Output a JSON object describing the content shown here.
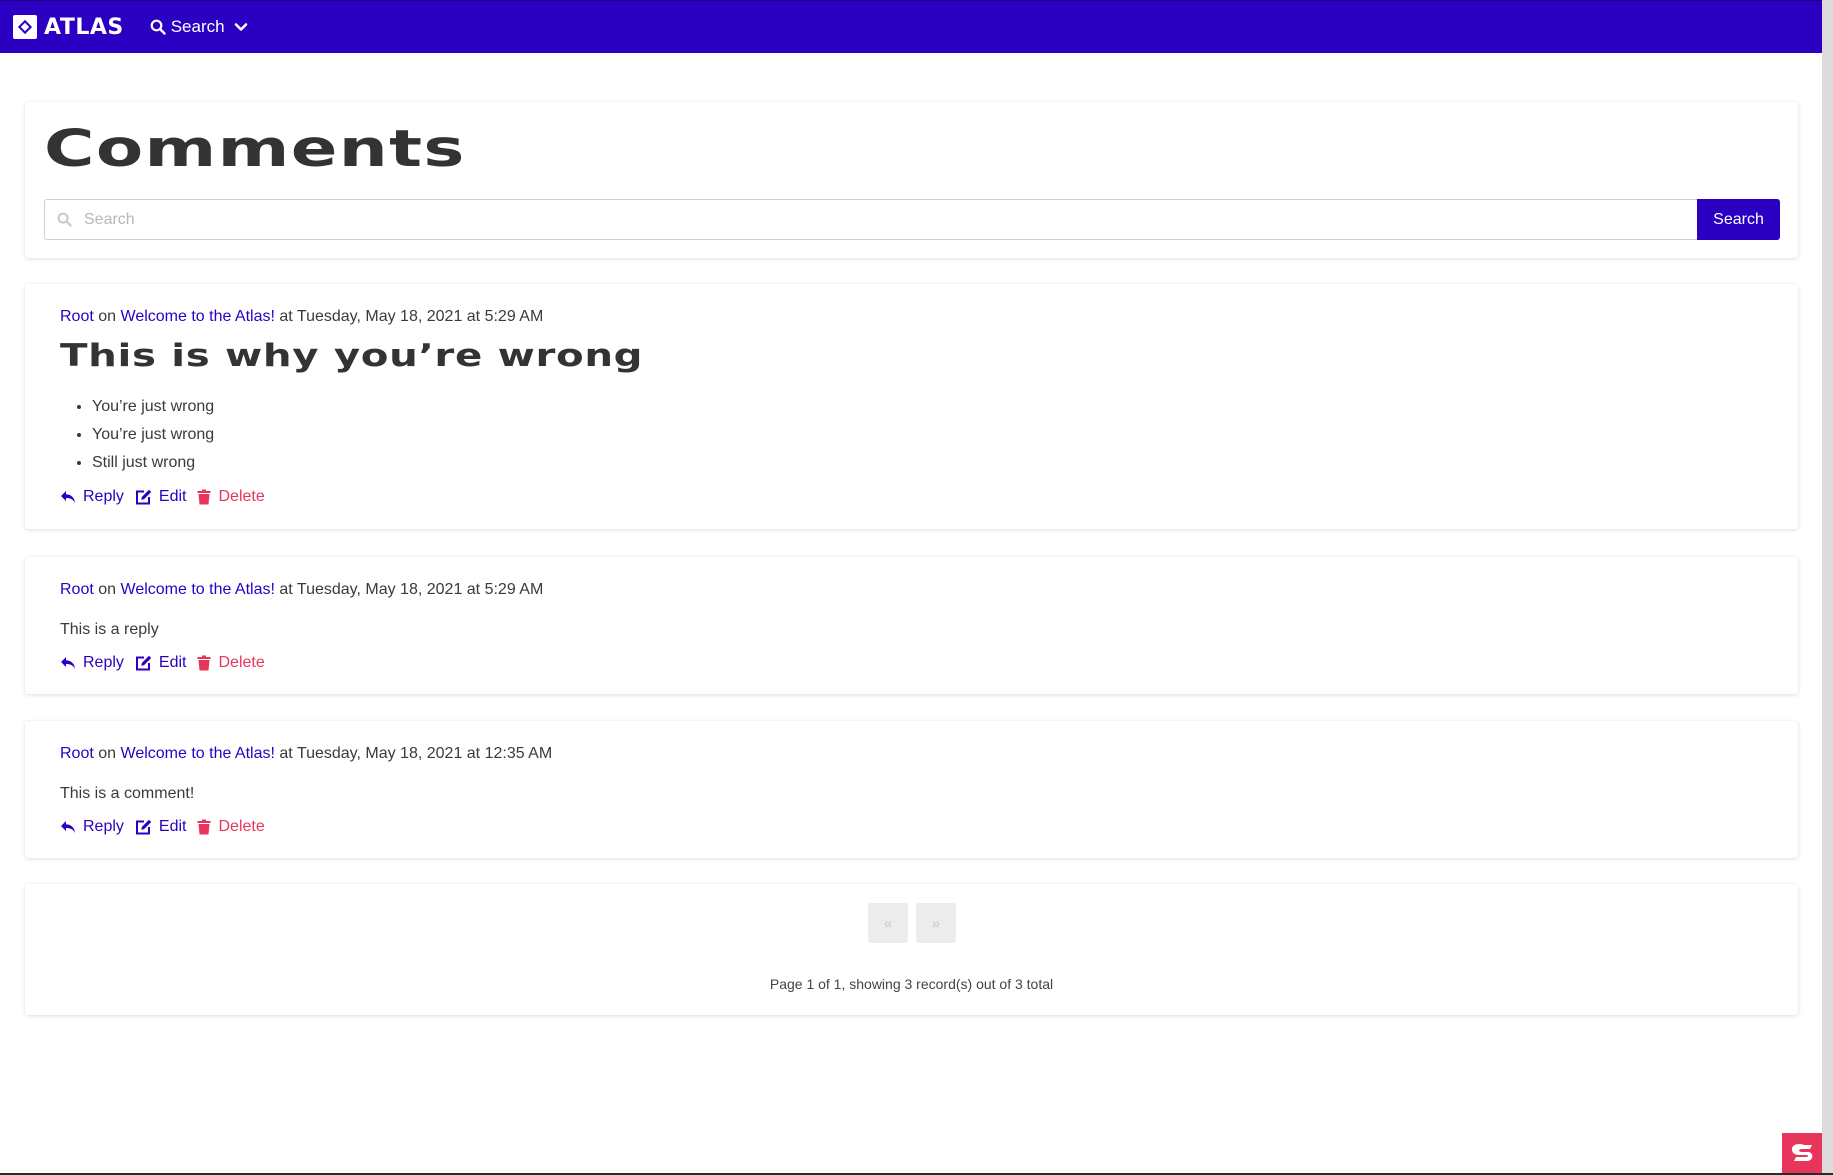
{
  "navbar": {
    "brand": "ATLAS",
    "search_label": "Search"
  },
  "header": {
    "title": "Comments",
    "search_placeholder": "Search",
    "search_button": "Search"
  },
  "comments": [
    {
      "author": "Root",
      "on_text": "on",
      "post": "Welcome to the Atlas!",
      "at_text": "at Tuesday, May 18, 2021 at 5:29 AM",
      "heading": "This is why you’re wrong",
      "list": [
        "You’re just wrong",
        "You’re just wrong",
        "Still just wrong"
      ]
    },
    {
      "author": "Root",
      "on_text": "on",
      "post": "Welcome to the Atlas!",
      "at_text": "at Tuesday, May 18, 2021 at 5:29 AM",
      "body": "This is a reply"
    },
    {
      "author": "Root",
      "on_text": "on",
      "post": "Welcome to the Atlas!",
      "at_text": "at Tuesday, May 18, 2021 at 12:35 AM",
      "body": "This is a comment!"
    }
  ],
  "actions": {
    "reply": "Reply",
    "edit": "Edit",
    "delete": "Delete"
  },
  "pagination": {
    "prev": "«",
    "next": "»",
    "info": "Page 1 of 1, showing 3 record(s) out of 3 total"
  },
  "colors": {
    "primary": "#2b00c2",
    "danger": "#e8355b",
    "text": "#3a3a3a"
  },
  "icons": {
    "brand": "diamond-logo-icon",
    "nav_search": "search-icon",
    "dropdown": "chevron-down-icon",
    "reply": "reply-icon",
    "edit": "edit-icon",
    "delete": "trash-icon",
    "corner": "app-badge-icon"
  }
}
